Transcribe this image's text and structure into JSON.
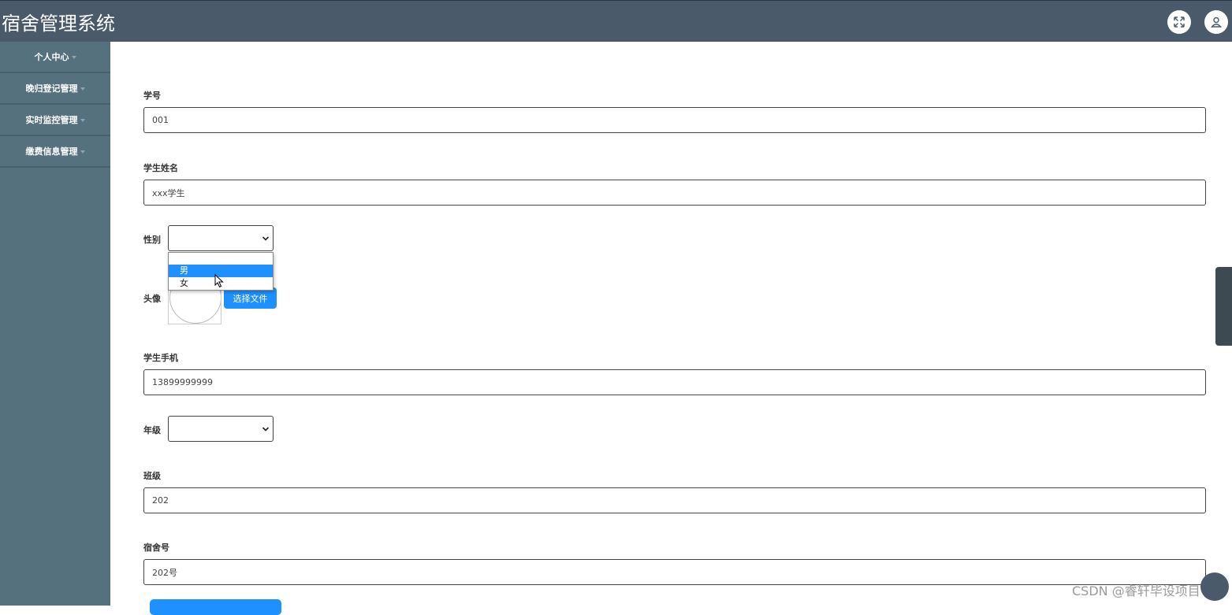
{
  "header": {
    "title": "宿舍管理系统",
    "icons": [
      "fullscreen-icon",
      "user-icon"
    ]
  },
  "sidebar": {
    "items": [
      {
        "label": "个人中心"
      },
      {
        "label": "晚归登记管理"
      },
      {
        "label": "实时监控管理"
      },
      {
        "label": "缴费信息管理"
      }
    ]
  },
  "form": {
    "student_id": {
      "label": "学号",
      "value": "001"
    },
    "student_name": {
      "label": "学生姓名",
      "value": "xxx学生"
    },
    "gender": {
      "label": "性别",
      "value": "",
      "options": [
        "",
        "男",
        "女"
      ],
      "highlighted": "男"
    },
    "avatar": {
      "label": "头像",
      "button": "选择文件"
    },
    "phone": {
      "label": "学生手机",
      "value": "13899999999"
    },
    "grade": {
      "label": "年级",
      "value": ""
    },
    "class": {
      "label": "班级",
      "value": "202"
    },
    "dorm": {
      "label": "宿舍号",
      "value": "202号"
    }
  },
  "watermark": "CSDN @睿轩毕设项目",
  "colors": {
    "header": "#4a5a6a",
    "sidebar": "#56717e",
    "accent": "#1e90ff"
  }
}
